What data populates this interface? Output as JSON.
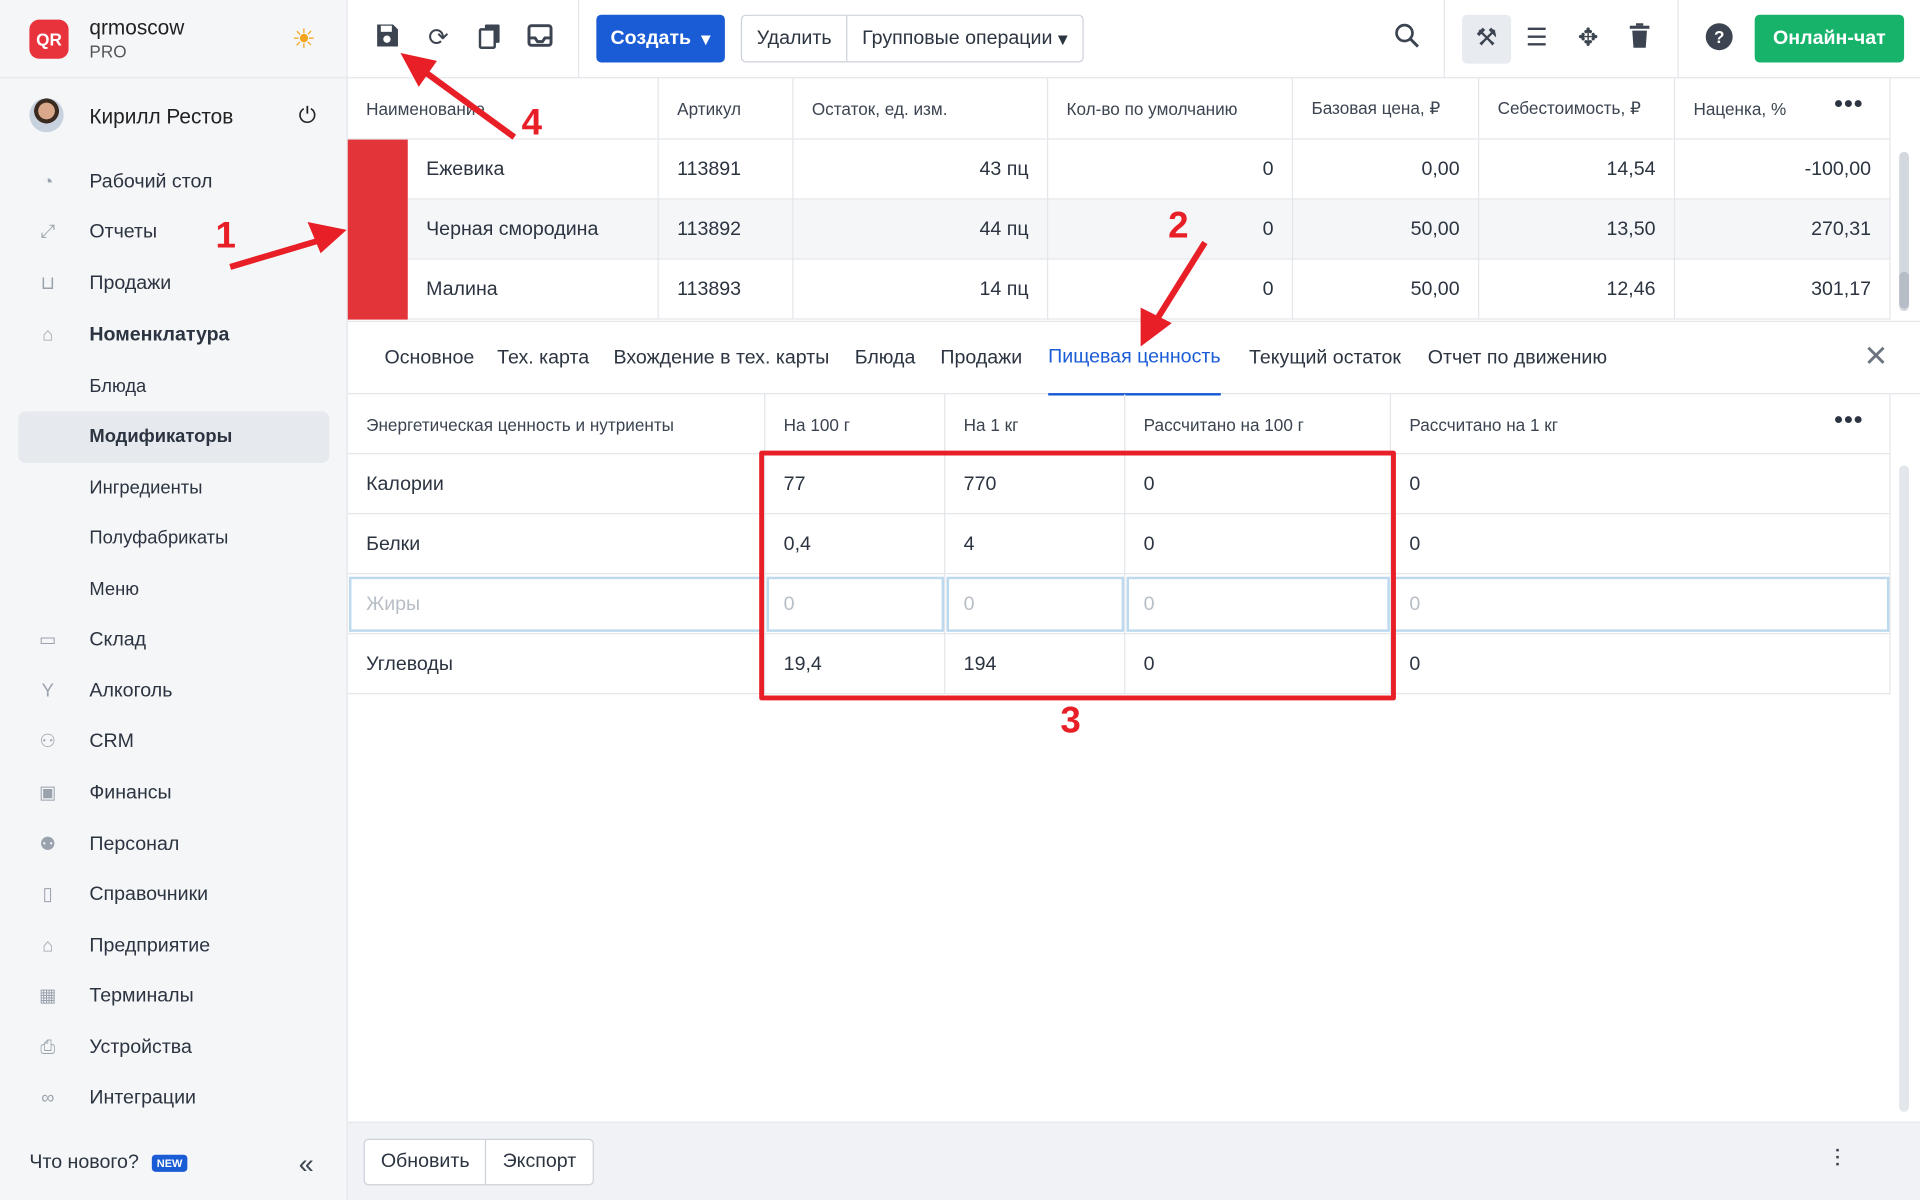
{
  "brand": {
    "logo": "QR",
    "name": "qrmoscow",
    "plan": "PRO"
  },
  "user": {
    "name": "Кирилл Рестов"
  },
  "nav": [
    {
      "label": "Рабочий стол",
      "icon": "dashboard-icon"
    },
    {
      "label": "Отчеты",
      "icon": "chart-icon"
    },
    {
      "label": "Продажи",
      "icon": "basket-icon"
    },
    {
      "label": "Номенклатура",
      "icon": "tag-icon",
      "bold": true
    },
    {
      "label": "Блюда",
      "sub": true
    },
    {
      "label": "Модификаторы",
      "sub": true,
      "active": true
    },
    {
      "label": "Ингредиенты",
      "sub": true
    },
    {
      "label": "Полуфабрикаты",
      "sub": true
    },
    {
      "label": "Меню",
      "sub": true
    },
    {
      "label": "Склад",
      "icon": "box-icon"
    },
    {
      "label": "Алкоголь",
      "icon": "glass-icon"
    },
    {
      "label": "CRM",
      "icon": "people-icon"
    },
    {
      "label": "Финансы",
      "icon": "wallet-icon"
    },
    {
      "label": "Персонал",
      "icon": "staff-icon"
    },
    {
      "label": "Справочники",
      "icon": "book-icon"
    },
    {
      "label": "Предприятие",
      "icon": "shop-icon"
    },
    {
      "label": "Терминалы",
      "icon": "terminal-icon"
    },
    {
      "label": "Устройства",
      "icon": "printer-icon"
    },
    {
      "label": "Интеграции",
      "icon": "link-icon"
    }
  ],
  "sidebar_footer": {
    "whats_new": "Что нового?",
    "badge": "NEW"
  },
  "toolbar": {
    "create": "Создать",
    "delete": "Удалить",
    "group_ops": "Групповые операции",
    "chat": "Онлайн-чат"
  },
  "items_table": {
    "headers": [
      "Наименование",
      "Артикул",
      "Остаток, ед. изм.",
      "Кол-во по умолчанию",
      "Базовая цена, ₽",
      "Себестоимость, ₽",
      "Наценка, %"
    ],
    "rows": [
      [
        "Ежевика",
        "113891",
        "43 пц",
        "0",
        "0,00",
        "14,54",
        "-100,00"
      ],
      [
        "Черная смородина",
        "113892",
        "44 пц",
        "0",
        "50,00",
        "13,50",
        "270,31"
      ],
      [
        "Малина",
        "113893",
        "14 пц",
        "0",
        "50,00",
        "12,46",
        "301,17"
      ]
    ]
  },
  "detail_tabs": [
    "Основное",
    "Тех. карта",
    "Вхождение в тех. карты",
    "Блюда",
    "Продажи",
    "Пищевая ценность",
    "Текущий остаток",
    "Отчет по движению"
  ],
  "active_tab": "Пищевая ценность",
  "nutrition_table": {
    "headers": [
      "Энергетическая ценность и нутриенты",
      "На 100 г",
      "На 1 кг",
      "Рассчитано на 100 г",
      "Рассчитано на 1 кг"
    ],
    "rows": [
      [
        "Калории",
        "77",
        "770",
        "0",
        "0"
      ],
      [
        "Белки",
        "0,4",
        "4",
        "0",
        "0"
      ],
      [
        "Жиры",
        "0",
        "0",
        "0",
        "0"
      ],
      [
        "Углеводы",
        "19,4",
        "194",
        "0",
        "0"
      ]
    ]
  },
  "footer": {
    "refresh": "Обновить",
    "export": "Экспорт"
  },
  "annotations": {
    "n1": "1",
    "n2": "2",
    "n3": "3",
    "n4": "4"
  },
  "colors": {
    "accent": "#1a5cd6",
    "chat": "#18b36b",
    "annotation": "#e81f26",
    "row_marker": "#e3343a"
  }
}
